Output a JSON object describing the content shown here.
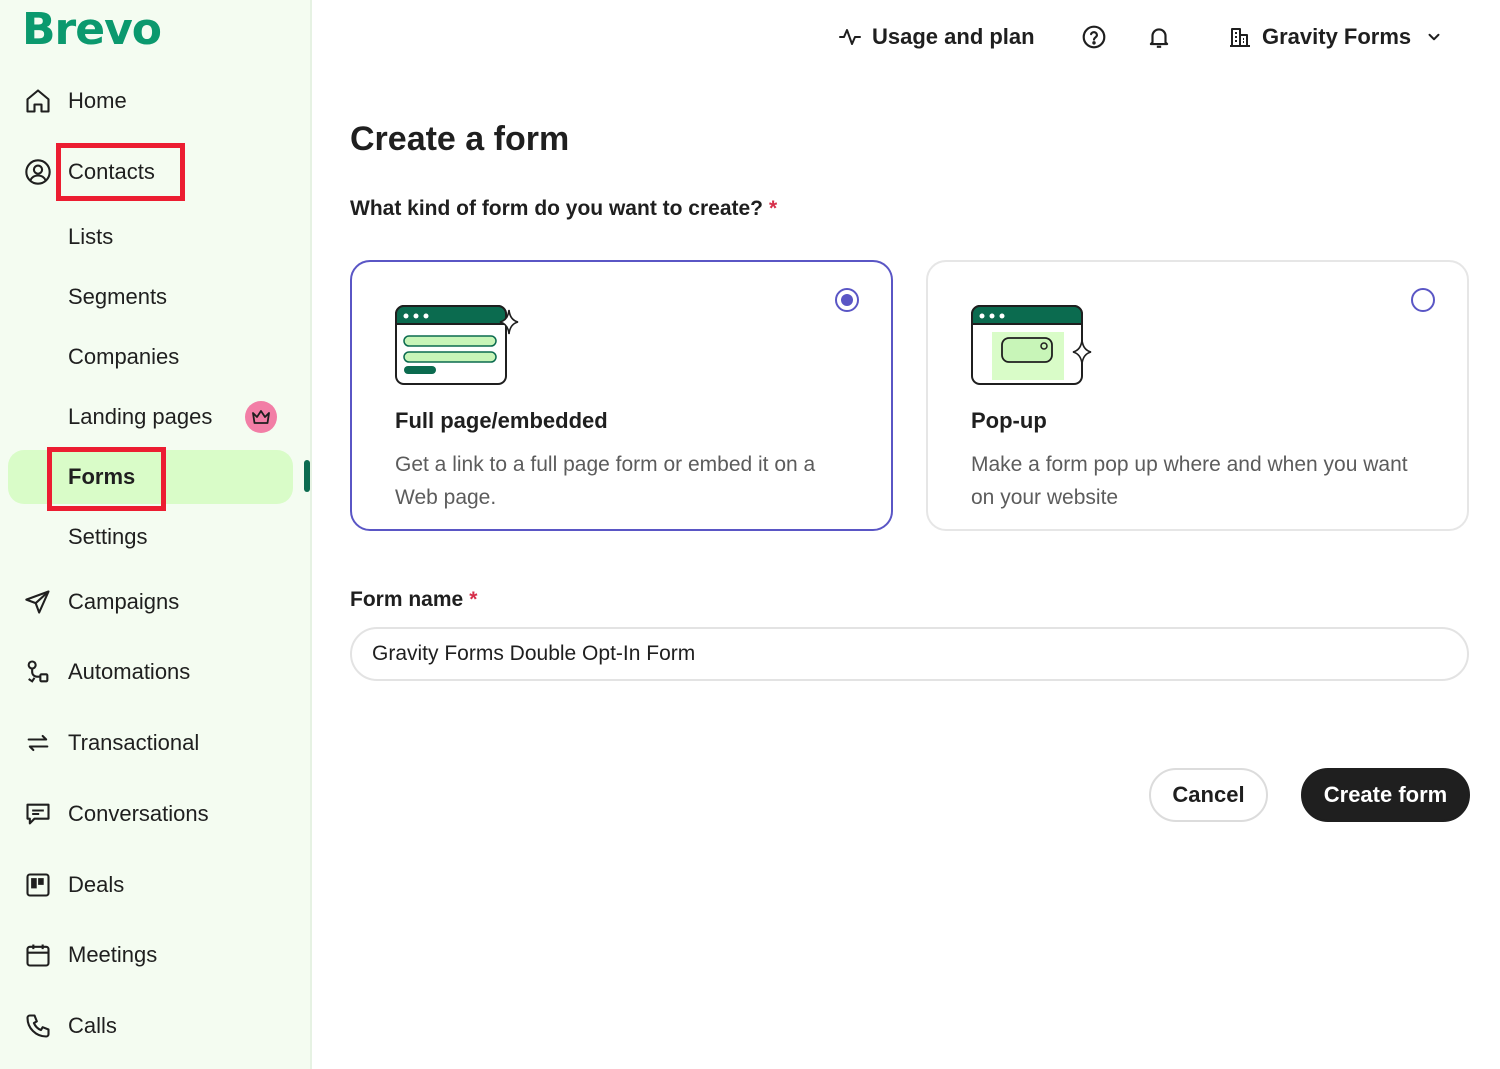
{
  "brand": {
    "logo_text": "Brevo",
    "color": "#0b996e"
  },
  "sidebar": {
    "items": [
      {
        "key": "home",
        "label": "Home",
        "icon": "home-icon"
      },
      {
        "key": "contacts",
        "label": "Contacts",
        "icon": "user-circle-icon"
      },
      {
        "key": "lists",
        "label": "Lists"
      },
      {
        "key": "segments",
        "label": "Segments"
      },
      {
        "key": "companies",
        "label": "Companies"
      },
      {
        "key": "landing_pages",
        "label": "Landing pages",
        "badge_icon": "crown-icon"
      },
      {
        "key": "forms",
        "label": "Forms",
        "active": true
      },
      {
        "key": "settings",
        "label": "Settings"
      },
      {
        "key": "campaigns",
        "label": "Campaigns",
        "icon": "paper-plane-icon"
      },
      {
        "key": "automations",
        "label": "Automations",
        "icon": "automation-icon"
      },
      {
        "key": "transactional",
        "label": "Transactional",
        "icon": "arrows-exchange-icon"
      },
      {
        "key": "conversations",
        "label": "Conversations",
        "icon": "chat-icon"
      },
      {
        "key": "deals",
        "label": "Deals",
        "icon": "kanban-icon"
      },
      {
        "key": "meetings",
        "label": "Meetings",
        "icon": "calendar-icon"
      },
      {
        "key": "calls",
        "label": "Calls",
        "icon": "phone-icon"
      }
    ],
    "highlight_color": "#ec1d31",
    "active_bg": "#d9fcc8"
  },
  "topbar": {
    "usage_label": "Usage and plan",
    "account_label": "Gravity Forms"
  },
  "main": {
    "title": "Create a form",
    "question": "What kind of form do you want to create?",
    "required_mark": "*",
    "options": [
      {
        "title": "Full page/embedded",
        "description": "Get a link to a full page form or embed it on a Web page.",
        "selected": true
      },
      {
        "title": "Pop-up",
        "description": "Make a form pop up where and when you want on your website",
        "selected": false
      }
    ],
    "form_name": {
      "label": "Form name",
      "value": "Gravity Forms Double Opt-In Form"
    },
    "cancel_label": "Cancel",
    "create_label": "Create form"
  },
  "colors": {
    "accent": "#5a56c5",
    "dark": "#1f1f1f",
    "required": "#d62e4a"
  }
}
